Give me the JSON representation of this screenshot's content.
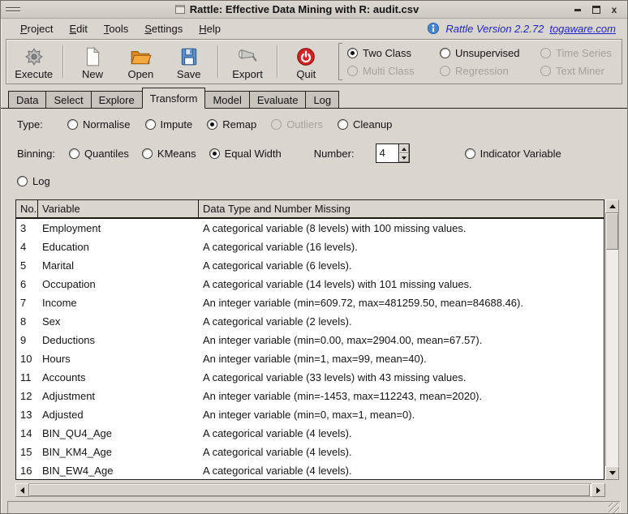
{
  "window": {
    "title": "Rattle: Effective Data Mining with R: audit.csv"
  },
  "menubar": {
    "items": [
      "Project",
      "Edit",
      "Tools",
      "Settings",
      "Help"
    ],
    "version_text": "Rattle Version 2.2.72",
    "version_link": "togaware.com"
  },
  "toolbar": {
    "buttons": [
      "Execute",
      "New",
      "Open",
      "Save",
      "Export",
      "Quit"
    ],
    "model_radios": [
      {
        "label": "Two Class",
        "selected": true,
        "enabled": true
      },
      {
        "label": "Unsupervised",
        "selected": false,
        "enabled": true
      },
      {
        "label": "Time Series",
        "selected": false,
        "enabled": false
      },
      {
        "label": "Multi Class",
        "selected": false,
        "enabled": false
      },
      {
        "label": "Regression",
        "selected": false,
        "enabled": false
      },
      {
        "label": "Text Miner",
        "selected": false,
        "enabled": false
      }
    ]
  },
  "tabs": [
    {
      "label": "Data",
      "active": false
    },
    {
      "label": "Select",
      "active": false
    },
    {
      "label": "Explore",
      "active": false
    },
    {
      "label": "Transform",
      "active": true
    },
    {
      "label": "Model",
      "active": false
    },
    {
      "label": "Evaluate",
      "active": false
    },
    {
      "label": "Log",
      "active": false
    }
  ],
  "transform": {
    "type_label": "Type:",
    "type_options": [
      {
        "label": "Normalise",
        "selected": false,
        "enabled": true
      },
      {
        "label": "Impute",
        "selected": false,
        "enabled": true
      },
      {
        "label": "Remap",
        "selected": true,
        "enabled": true
      },
      {
        "label": "Outliers",
        "selected": false,
        "enabled": false
      },
      {
        "label": "Cleanup",
        "selected": false,
        "enabled": true
      }
    ],
    "binning_label": "Binning:",
    "binning_options": [
      {
        "label": "Quantiles",
        "selected": false,
        "enabled": true
      },
      {
        "label": "KMeans",
        "selected": false,
        "enabled": true
      },
      {
        "label": "Equal Width",
        "selected": true,
        "enabled": true
      }
    ],
    "number_label": "Number:",
    "number_value": "4",
    "indicator_label": "Indicator Variable",
    "log_label": "Log"
  },
  "table": {
    "columns": [
      "No.",
      "Variable",
      "Data Type and Number Missing"
    ],
    "rows": [
      [
        "3",
        "Employment",
        "A categorical variable (8 levels) with 100 missing values."
      ],
      [
        "4",
        "Education",
        "A categorical variable (16 levels)."
      ],
      [
        "5",
        "Marital",
        "A categorical variable (6 levels)."
      ],
      [
        "6",
        "Occupation",
        "A categorical variable (14 levels) with 101 missing values."
      ],
      [
        "7",
        "Income",
        "An integer variable (min=609.72, max=481259.50, mean=84688.46)."
      ],
      [
        "8",
        "Sex",
        "A categorical variable (2 levels)."
      ],
      [
        "9",
        "Deductions",
        "An integer variable (min=0.00, max=2904.00, mean=67.57)."
      ],
      [
        "10",
        "Hours",
        "An integer variable (min=1, max=99, mean=40)."
      ],
      [
        "11",
        "Accounts",
        "A categorical variable (33 levels) with 43 missing values."
      ],
      [
        "12",
        "Adjustment",
        "An integer variable (min=-1453, max=112243, mean=2020)."
      ],
      [
        "13",
        "Adjusted",
        "An integer variable (min=0, max=1, mean=0)."
      ],
      [
        "14",
        "BIN_QU4_Age",
        "A categorical variable (4 levels)."
      ],
      [
        "15",
        "BIN_KM4_Age",
        "A categorical variable (4 levels)."
      ],
      [
        "16",
        "BIN_EW4_Age",
        "A categorical variable (4 levels)."
      ]
    ]
  },
  "colors": {
    "link_blue": "#2323cd",
    "folder_orange": "#f09c38",
    "quit_red": "#d32222",
    "save_blue": "#5b8fc9"
  }
}
